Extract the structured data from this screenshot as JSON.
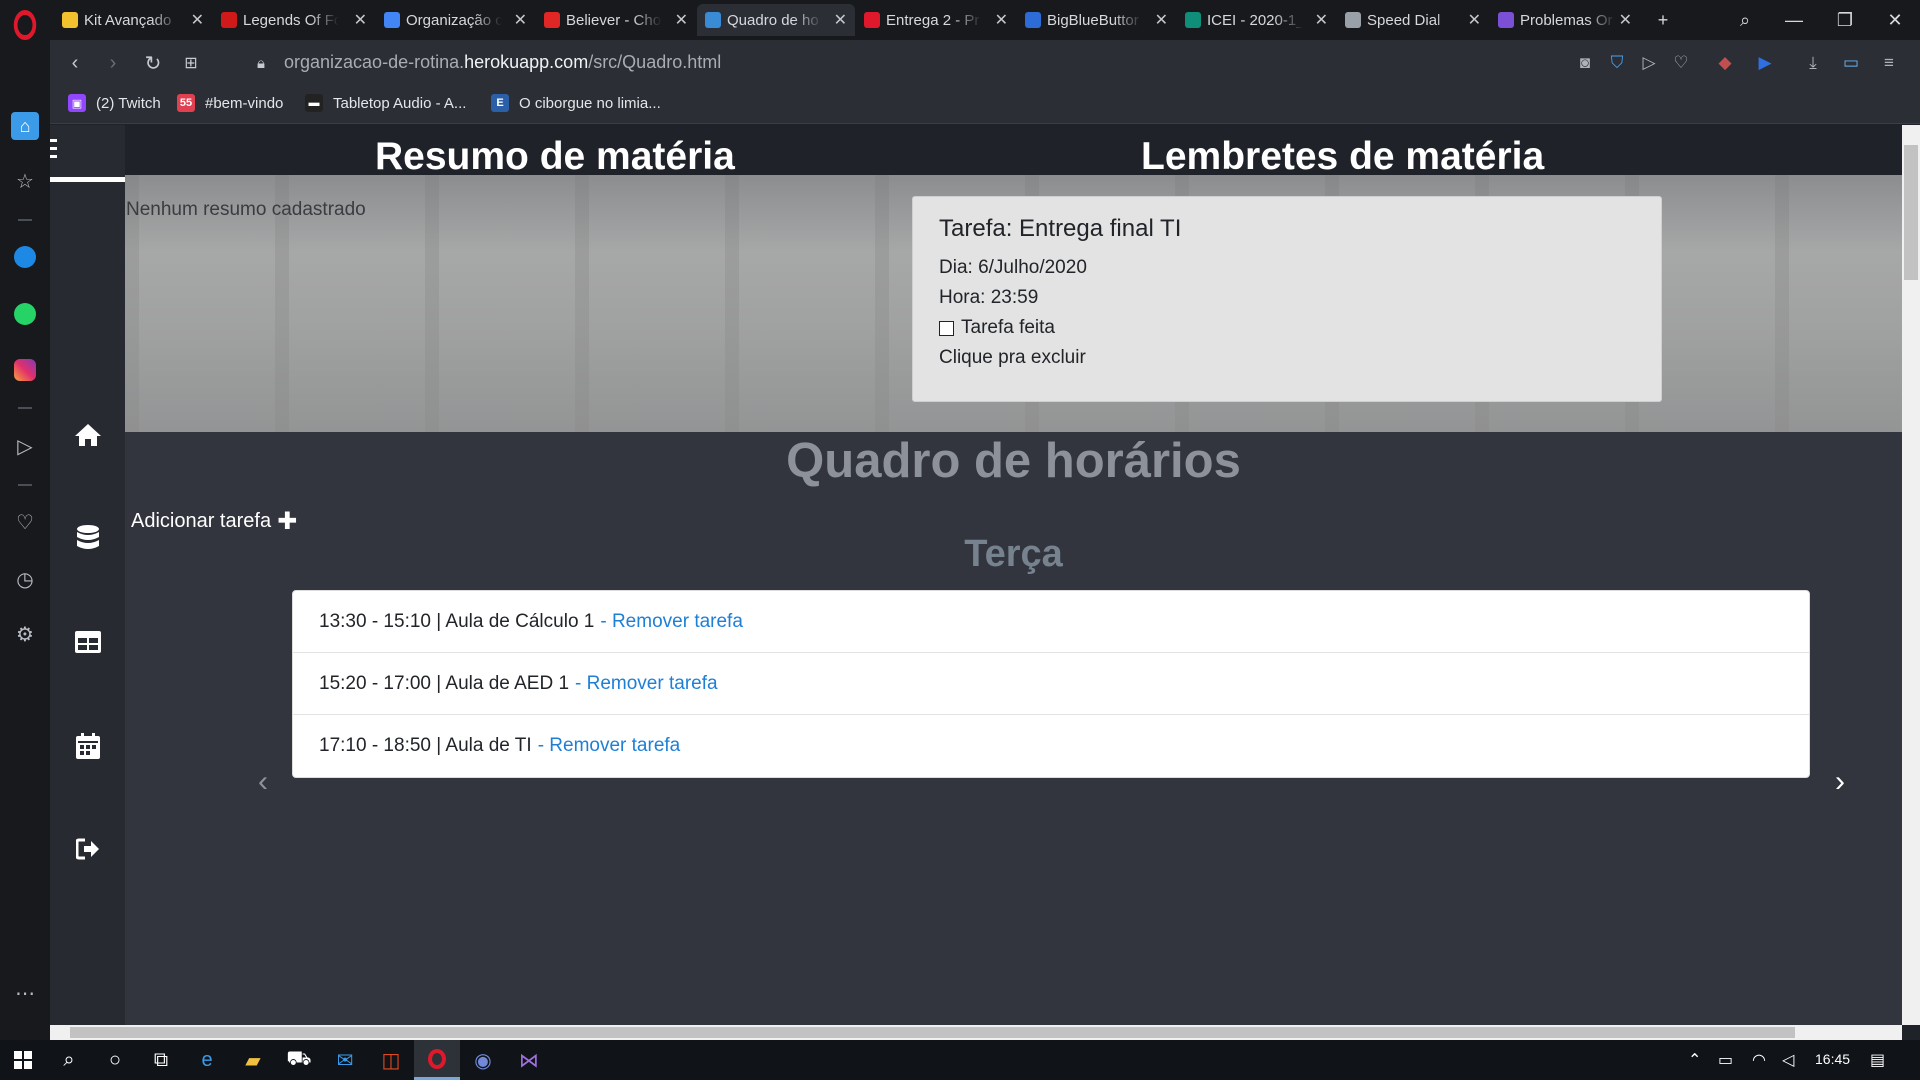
{
  "tabs": [
    {
      "title": "Kit Avançado",
      "fav_color": "#f2c12e",
      "active": false
    },
    {
      "title": "Legends Of Fc",
      "fav_color": "#d01a1a",
      "active": false
    },
    {
      "title": "Organização c",
      "fav_color": "#4285f4",
      "active": false
    },
    {
      "title": "Believer - Cho",
      "fav_color": "#e12626",
      "active": false
    },
    {
      "title": "Quadro de ho",
      "fav_color": "#3a8bd6",
      "active": true
    },
    {
      "title": "Entrega 2 - Pr",
      "fav_color": "#e0182b",
      "active": false
    },
    {
      "title": "BigBlueButtor",
      "fav_color": "#2d6bd6",
      "active": false
    },
    {
      "title": "ICEI - 2020-1_",
      "fav_color": "#0f8f7a",
      "active": false
    },
    {
      "title": "Speed Dial",
      "fav_color": "#9aa0a8",
      "active": false
    },
    {
      "title": "Problemas Or",
      "fav_color": "#7b4fd6",
      "active": false
    }
  ],
  "address": {
    "url_prefix": "organizacao-de-rotina.",
    "url_domain": "herokuapp.com",
    "url_path": "/src/Quadro.html"
  },
  "bookmarks": [
    {
      "label": "(2) Twitch",
      "color": "#9146ff",
      "glyph": "▣"
    },
    {
      "label": "#bem-vindo",
      "color": "#e04050",
      "glyph": "55"
    },
    {
      "label": "Tabletop Audio - A...",
      "color": "#222222",
      "glyph": "▬"
    },
    {
      "label": "O ciborgue no limia...",
      "color": "#2b5fa8",
      "glyph": "E"
    }
  ],
  "page": {
    "resumo_title": "Resumo de matéria",
    "resumo_empty": "Nenhum resumo cadastrado",
    "lembretes_title": "Lembretes de matéria",
    "reminder": {
      "title": "Tarefa: Entrega final TI",
      "dia": "Dia: 6/Julho/2020",
      "hora": "Hora: 23:59",
      "feita": "Tarefa feita",
      "excluir": "Clique pra excluir"
    },
    "quadro_title": "Quadro de horários",
    "add_task": "Adicionar tarefa",
    "day": "Terça",
    "tasks": [
      {
        "text": "13:30 - 15:10 | Aula de Cálculo 1",
        "remove": "- Remover tarefa"
      },
      {
        "text": "15:20 - 17:00 | Aula de AED 1",
        "remove": "- Remover tarefa"
      },
      {
        "text": "17:10 - 18:50 | Aula de TI",
        "remove": "- Remover tarefa"
      }
    ]
  },
  "taskbar": {
    "time": "16:45"
  }
}
